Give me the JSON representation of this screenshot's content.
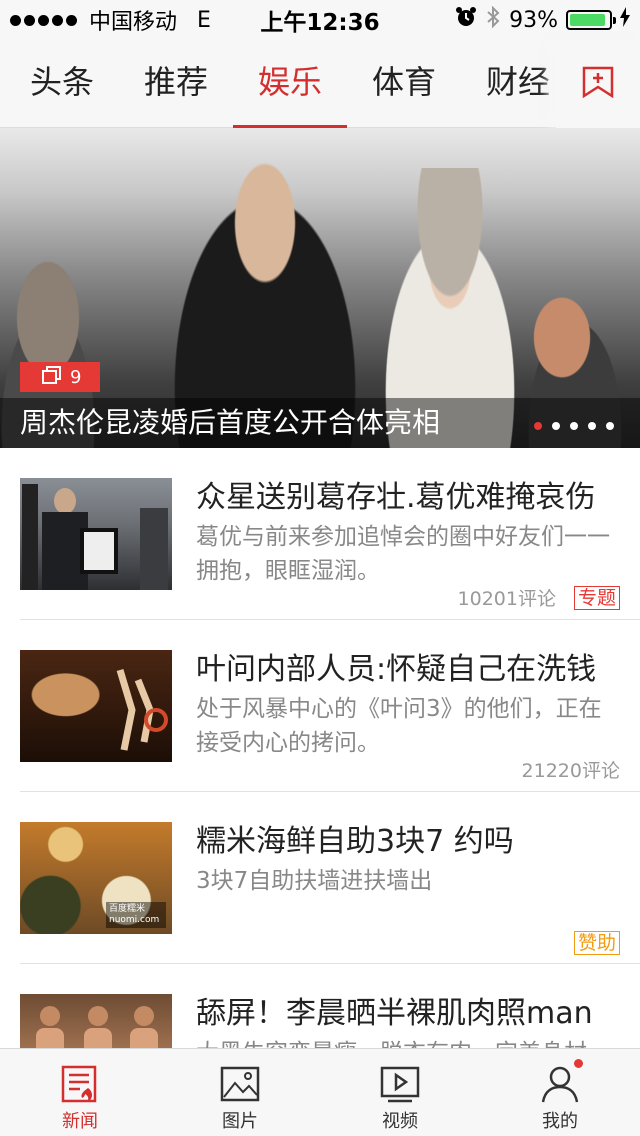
{
  "status_bar": {
    "carrier": "中国移动",
    "network": "E",
    "time": "上午12:36",
    "battery": "93%",
    "battery_level": 0.93
  },
  "tabs": [
    {
      "label": "头条",
      "active": false
    },
    {
      "label": "推荐",
      "active": false
    },
    {
      "label": "娱乐",
      "active": true
    },
    {
      "label": "体育",
      "active": false
    },
    {
      "label": "财经",
      "active": false
    }
  ],
  "hero": {
    "photo_count": "9",
    "title": "周杰伦昆凌婚后首度公开合体亮相",
    "slide_count": 5,
    "active_slide": 0
  },
  "news": [
    {
      "title": "众星送别葛存壮.葛优难掩哀伤",
      "digest": "葛优与前来参加追悼会的圈中好友们一一拥抱，眼眶湿润。",
      "comments": "10201评论",
      "tag": "专题"
    },
    {
      "title": "叶问内部人员:怀疑自己在洗钱",
      "digest": "处于风暴中心的《叶问3》的他们，正在接受内心的拷问。",
      "comments": "21220评论",
      "tag": ""
    },
    {
      "title": "糯米海鲜自助3块7 约吗",
      "digest": "3块7自助扶墙进扶墙出",
      "comments": "",
      "tag": "赞助",
      "thumb_watermark": "百度糯米 nuomi.com"
    },
    {
      "title": "舔屏！李晨晒半裸肌肉照man",
      "digest": "大黑牛突变暴瘦，脱衣有肉，完美身材",
      "comments": "",
      "tag": ""
    }
  ],
  "bottom_nav": [
    {
      "label": "新闻",
      "icon": "news-icon",
      "active": true
    },
    {
      "label": "图片",
      "icon": "picture-icon",
      "active": false
    },
    {
      "label": "视频",
      "icon": "video-icon",
      "active": false
    },
    {
      "label": "我的",
      "icon": "profile-icon",
      "active": false,
      "badge": true
    }
  ],
  "colors": {
    "accent": "#d32f2f",
    "sponsor": "#f39c12",
    "battery": "#4cd964"
  }
}
